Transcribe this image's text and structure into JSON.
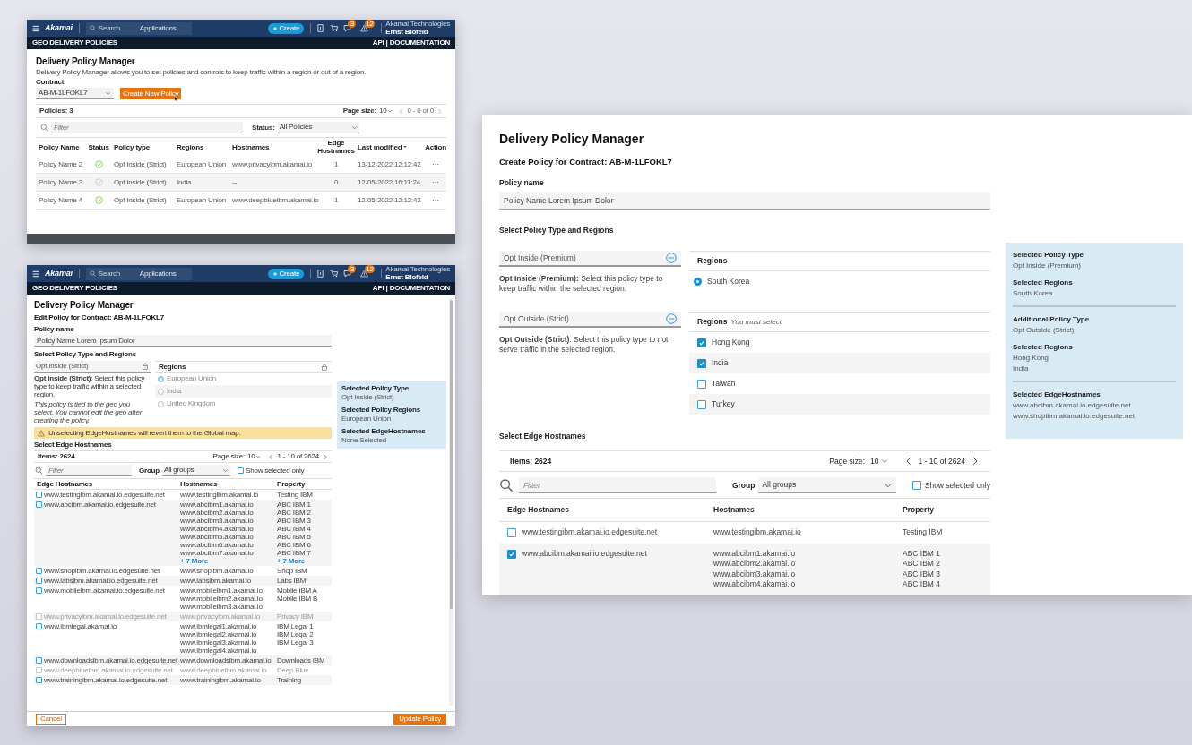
{
  "list_window": {
    "header": {
      "logo": "Akamai",
      "search_placeholder": "Search",
      "applications": "Applications",
      "create_button": "Create",
      "chat_badge": "3",
      "alert_badge": "12",
      "company": "Akamai Technologies",
      "user": "Ernst Blofeld"
    },
    "subbar": {
      "title": "GEO DELIVERY POLICIES",
      "links": "API | DOCUMENTATION"
    },
    "title": "Delivery Policy Manager",
    "description": "Delivery Policy Manager allows you to set policies and controls to keep traffic within a region or out of a region.",
    "contract_label": "Contract",
    "contract_value": "AB-M-1LFOKL7",
    "create_button": "Create New Policy",
    "count": "Policies: 3",
    "page_size_label": "Page size:",
    "page_size": "10",
    "range": "0 - 0 of 0",
    "filter_placeholder": "Filter",
    "status_label": "Status:",
    "status_value": "All Policies",
    "columns": [
      "Policy Name",
      "Status",
      "Policy type",
      "Regions",
      "Hostnames",
      "Edge Hostnames",
      "Last modified",
      "Action"
    ],
    "rows": [
      {
        "name": "Policy Name 2",
        "active": true,
        "type": "Opt Inside (Strict)",
        "regions": "European Union",
        "hostnames": "www.privacyibm.akamai.io",
        "edge_count": "1",
        "modified": "13-12-2022 12:12:42",
        "action": "···"
      },
      {
        "name": "Policy Name 3",
        "active": false,
        "type": "Opt Inside (Strict)",
        "regions": "India",
        "hostnames": "--",
        "edge_count": "0",
        "modified": "12-05-2022 16:11:24",
        "action": "···"
      },
      {
        "name": "Policy Name 4",
        "active": true,
        "type": "Opt Inside (Strict)",
        "regions": "European Union",
        "hostnames": "www.deepblueibm.akamai.io",
        "edge_count": "1",
        "modified": "12-05-2022 12:12:42",
        "action": "···"
      }
    ]
  },
  "edit_window": {
    "header": {
      "logo": "Akamai",
      "search_placeholder": "Search",
      "applications": "Applications",
      "create_button": "Create",
      "chat_badge": "3",
      "alert_badge": "12",
      "company": "Akamai Technologies",
      "user": "Ernst Blofeld"
    },
    "subbar": {
      "title": "GEO DELIVERY POLICIES",
      "links": "API | DOCUMENTATION"
    },
    "title": "Delivery Policy Manager",
    "subtitle": "Edit Policy for Contract: AB-M-1LFOKL7",
    "policy_name_label": "Policy name",
    "policy_name_value": "Policy Name Lorem Ipsum Dolor",
    "section_types": "Select Policy Type and Regions",
    "policy_type": "Opt Inside (Strict)",
    "locked": true,
    "description": "**Opt Inside (Strict)**: Select this policy type to keep traffic within a selected region.",
    "note": "This policy is tied to the geo you select. You cannot edit the geo after creating the policy.",
    "regions_label": "Regions",
    "regions": [
      {
        "label": "European Union",
        "selected": true
      },
      {
        "label": "India",
        "selected": false
      },
      {
        "label": "United Kingdom",
        "selected": false
      }
    ],
    "summary": [
      {
        "label": "Selected Policy Type",
        "value": "Opt Inside (Strict)"
      },
      {
        "label": "Selected Policy Regions",
        "value": "European Union"
      },
      {
        "label": "Selected EdgeHostnames",
        "value": "None Selected"
      }
    ],
    "warning": "Unselecting EdgeHostnames will revert them to the Global map.",
    "section_hostnames": "Select Edge Hostnames",
    "items": "Items: 2624",
    "page_size_label": "Page size:",
    "page_size": "10",
    "range": "1 - 10 of 2624",
    "filter_placeholder": "Filter",
    "group_label": "Group",
    "group_value": "All groups",
    "show_selected": {
      "label": "Show selected only",
      "checked": false
    },
    "columns": [
      "Edge Hostnames",
      "Hostnames",
      "Property"
    ],
    "rows": [
      {
        "edge": "www.testingibm.akamai.io.edgesuite.net",
        "hostnames": [
          "www.testingibm.akamai.io"
        ],
        "properties": [
          "Testing IBM"
        ],
        "checked": false,
        "disabled": false
      },
      {
        "edge": "www.abcibm.akamai.io.edgesuite.net",
        "hostnames": [
          "www.abcibm1.akamai.io",
          "www.abcibm2.akamai.io",
          "www.abcibm3.akamai.io",
          "www.abcibm4.akamai.io",
          "www.abcibm5.akamai.io",
          "www.abcibm6.akamai.io",
          "www.abcibm7.akamai.io"
        ],
        "hostnames_more": "+ 7 More",
        "properties": [
          "ABC IBM 1",
          "ABC IBM 2",
          "ABC IBM 3",
          "ABC IBM 4",
          "ABC IBM 5",
          "ABC IBM 6",
          "ABC IBM 7"
        ],
        "properties_more": "+ 7 More",
        "checked": false,
        "disabled": false
      },
      {
        "edge": "www.shopibm.akamai.io.edgesuite.net",
        "hostnames": [
          "www.shopibm.akamai.io"
        ],
        "properties": [
          "Shop IBM"
        ],
        "checked": false,
        "disabled": false
      },
      {
        "edge": "www.labsibm.akamai.io.edgesuite.net",
        "hostnames": [
          "www.labsibm.akamai.io"
        ],
        "properties": [
          "Labs IBM"
        ],
        "checked": false,
        "disabled": false
      },
      {
        "edge": "www.mobileibm.akamai.io.edgesuite.net",
        "hostnames": [
          "www.mobileibm1.akamai.io",
          "www.mobileibm2.akamai.io",
          "www.mobileibm3.akamai.io"
        ],
        "properties": [
          "Mobile IBM A",
          "Mobile IBM B"
        ],
        "checked": false,
        "disabled": false
      },
      {
        "edge": "www.privacyibm.akamai.io.edgesuite.net",
        "hostnames": [
          "www.privacyibm.akamai.io"
        ],
        "properties": [
          "Privacy IBM"
        ],
        "checked": false,
        "disabled": true
      },
      {
        "edge": "www.ibmlegal.akamai.io",
        "hostnames": [
          "www.ibmlegal1.akamai.io",
          "www.ibmlegal2.akamai.io",
          "www.ibmlegal3.akamai.io",
          "www.ibmlegal4.akamai.io"
        ],
        "properties": [
          "IBM Legal 1",
          "IBM Legal 2",
          "IBM Legal 3"
        ],
        "checked": false,
        "disabled": false
      },
      {
        "edge": "www.downloadsibm.akamai.io.edgesuite.net",
        "hostnames": [
          "www.downloadsibm.akamai.io"
        ],
        "properties": [
          "Downloads IBM"
        ],
        "checked": false,
        "disabled": false
      },
      {
        "edge": "www.deepblueibm.akamai.io.edgesuite.net",
        "hostnames": [
          "www.deepblueibm.akamai.io"
        ],
        "properties": [
          "Deep Blue"
        ],
        "checked": false,
        "disabled": true
      },
      {
        "edge": "www.trainingibm.akamai.io.edgesuite.net",
        "hostnames": [
          "www.trainingibm.akamai.io"
        ],
        "properties": [
          "Training"
        ],
        "checked": false,
        "disabled": false
      }
    ],
    "cancel_button": "Cancel",
    "update_button": "Update Policy"
  },
  "create_panel": {
    "title": "Delivery Policy Manager",
    "subtitle": "Create Policy for Contract: AB-M-1LFOKL7",
    "policy_name_label": "Policy name",
    "policy_name_value": "Policy Name Lorem Ipsum Dolor",
    "section_types": "Select Policy Type and Regions",
    "policy_types": [
      {
        "label": "Opt Inside (Premium)",
        "description": "**Opt Inside (Premium):** Select this policy type to keep traffic within the selected region.",
        "regions_label": "Regions",
        "regions": [
          {
            "kind": "radio",
            "label": "South Korea",
            "selected": true
          }
        ]
      },
      {
        "label": "Opt Outside (Strict)",
        "description": "**Opt Outside (Strict)**: Select this policy type to not serve traffic in the selected region.",
        "regions_label": "Regions",
        "regions_note": "You must select",
        "regions": [
          {
            "kind": "checkbox",
            "label": "Hong Kong",
            "checked": true
          },
          {
            "kind": "checkbox",
            "label": "India",
            "checked": true
          },
          {
            "kind": "checkbox",
            "label": "Taiwan",
            "checked": false
          },
          {
            "kind": "checkbox",
            "label": "Turkey",
            "checked": false
          }
        ]
      }
    ],
    "summary_groups": [
      {
        "items": [
          {
            "label": "Selected Policy Type",
            "lines": [
              "Opt Inside (Premium)"
            ]
          },
          {
            "label": "Selected Regions",
            "lines": [
              "South Korea"
            ]
          }
        ]
      },
      {
        "items": [
          {
            "label": "Additional Policy Type",
            "lines": [
              "Opt Outside (Strict)"
            ]
          },
          {
            "label": "Selected Regions",
            "lines": [
              "Hong Kong",
              "India"
            ]
          }
        ]
      },
      {
        "items": [
          {
            "label": "Selected EdgeHostnames",
            "lines": [
              "www.abcibm.akamai.io.edgesuite.net",
              "www.shopibm.akamai.io.edgesuite.net"
            ]
          }
        ]
      }
    ],
    "section_hostnames": "Select Edge Hostnames",
    "items": "Items: 2624",
    "page_size_label": "Page size:",
    "page_size": "10",
    "range": "1 - 10 of 2624",
    "filter_placeholder": "Filter",
    "group_label": "Group",
    "group_value": "All groups",
    "show_selected": {
      "label": "Show selected only",
      "checked": false
    },
    "columns": [
      "Edge Hostnames",
      "Hostnames",
      "Property"
    ],
    "rows": [
      {
        "edge": "www.testingibm.akamai.io.edgesuite.net",
        "hostnames": [
          "www.testingibm.akamai.io"
        ],
        "properties": [
          "Testing IBM"
        ],
        "checked": false
      },
      {
        "edge": "www.abcibm.akamai.io.edgesuite.net",
        "hostnames": [
          "www.abcibm1.akamai.io",
          "www.abcibm2.akamai.io",
          "www.abcibm3.akamai.io",
          "www.abcibm4.akamai.io"
        ],
        "properties": [
          "ABC IBM 1",
          "ABC IBM 2",
          "ABC IBM 3",
          "ABC IBM 4"
        ],
        "checked": true
      }
    ]
  }
}
